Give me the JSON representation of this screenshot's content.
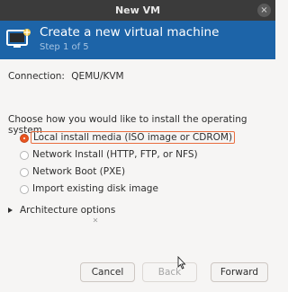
{
  "window": {
    "title": "New VM",
    "close_glyph": "×"
  },
  "banner": {
    "title": "Create a new virtual machine",
    "subtitle": "Step 1 of 5",
    "icon": "virtual-machine-icon",
    "background": "#1d64a8"
  },
  "connection": {
    "label": "Connection:",
    "value": "QEMU/KVM"
  },
  "install": {
    "question": "Choose how you would like to install the operating system",
    "options": [
      {
        "label": "Local install media (ISO image or CDROM)",
        "selected": true
      },
      {
        "label": "Network Install (HTTP, FTP, or NFS)",
        "selected": false
      },
      {
        "label": "Network Boot (PXE)",
        "selected": false
      },
      {
        "label": "Import existing disk image",
        "selected": false
      }
    ]
  },
  "architecture": {
    "label": "Architecture options",
    "expanded": false
  },
  "buttons": {
    "cancel": "Cancel",
    "back": "Back",
    "forward": "Forward"
  },
  "colors": {
    "accent": "#e95420",
    "titlebar": "#3b3b3b"
  }
}
